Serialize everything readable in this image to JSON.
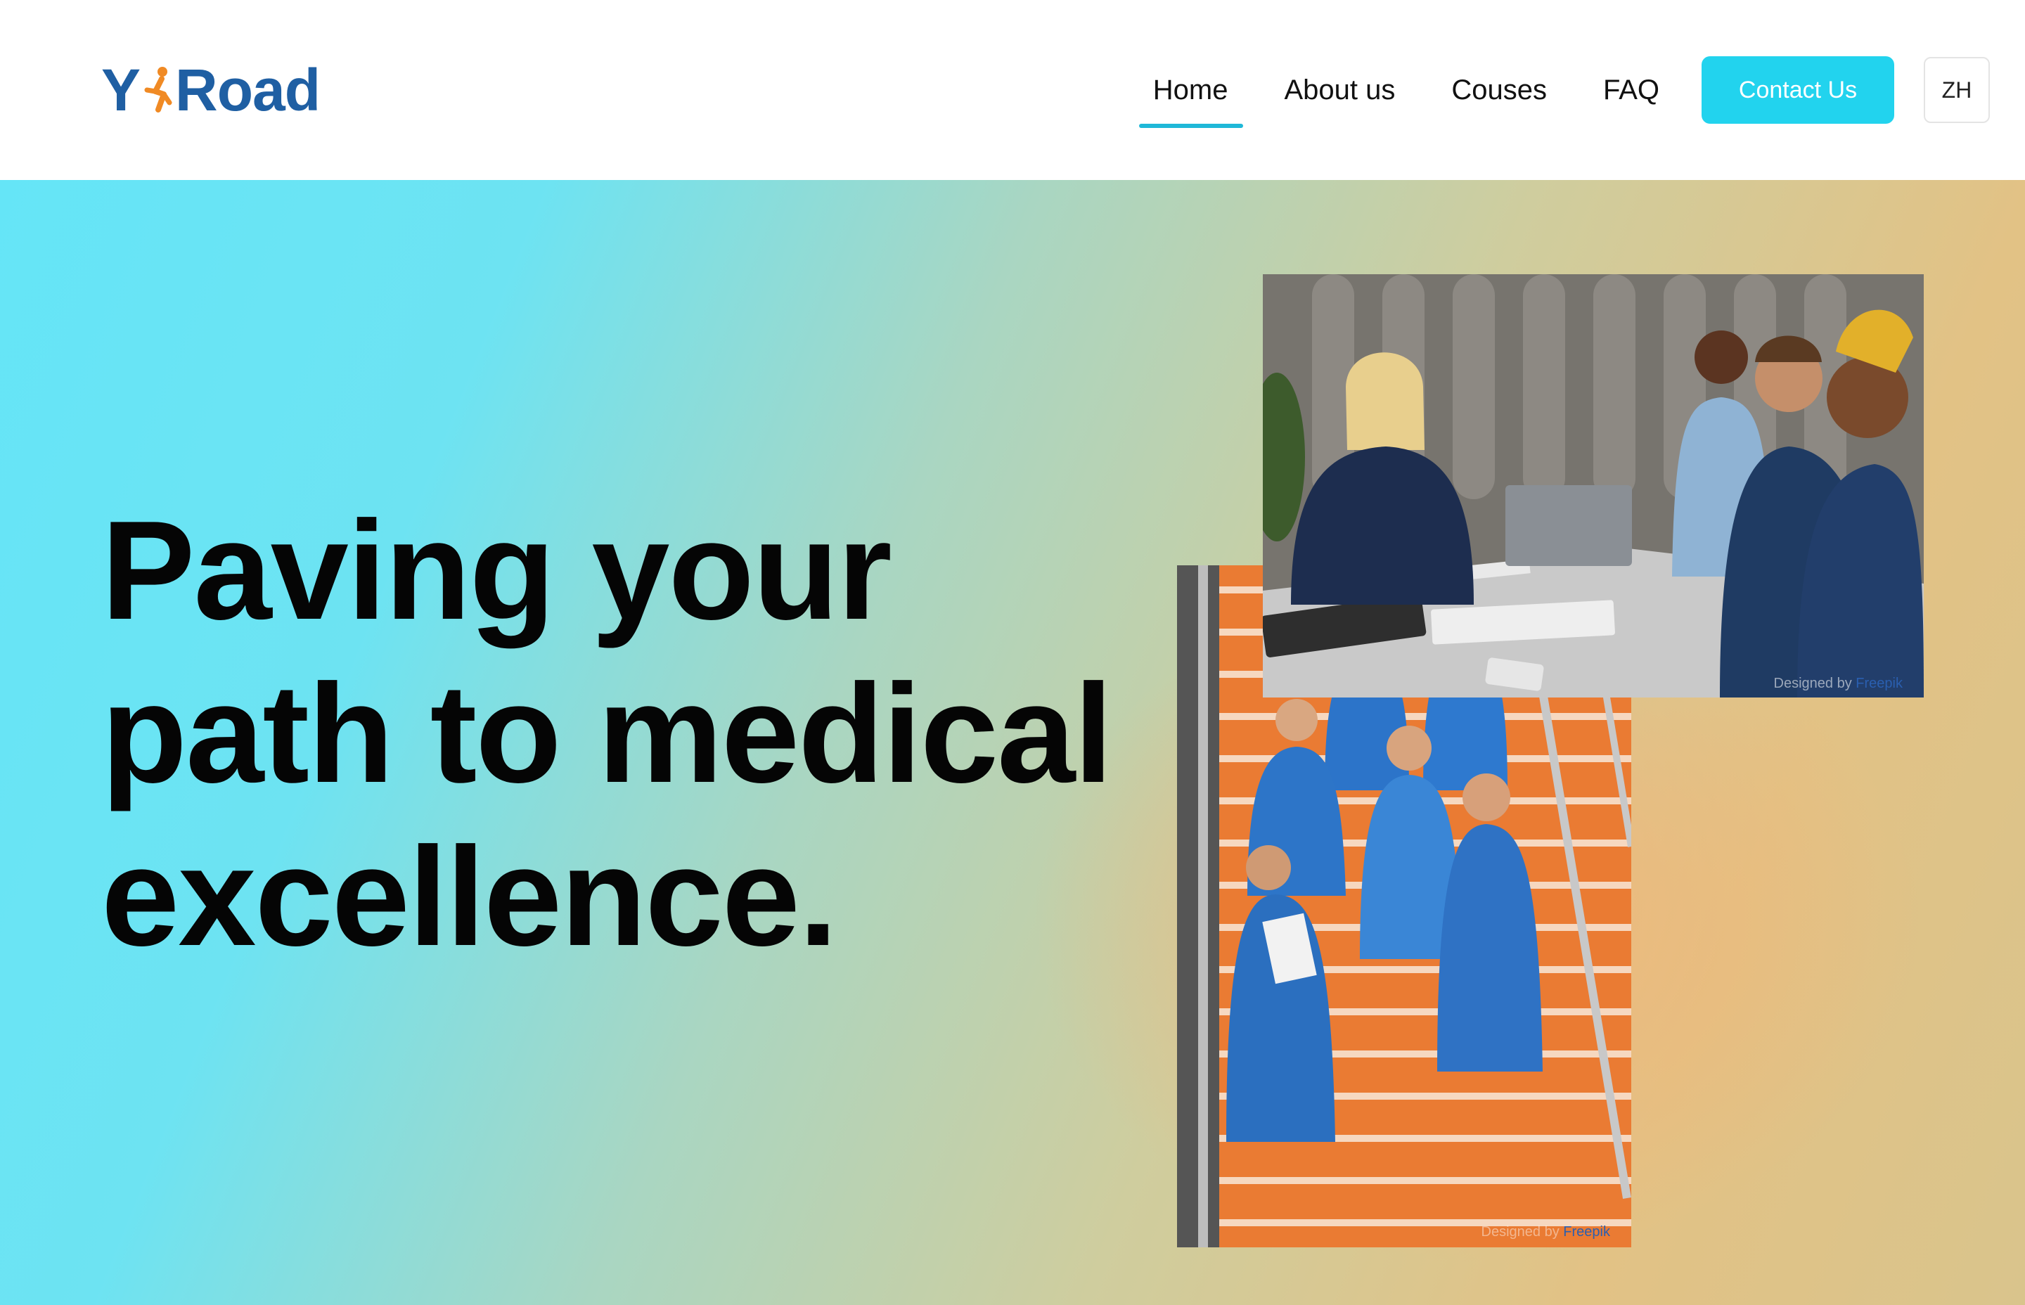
{
  "header": {
    "logo": {
      "text_left": "Y",
      "text_right": "Road",
      "icon": "runner-logo-icon"
    },
    "nav": [
      {
        "label": "Home",
        "active": true
      },
      {
        "label": "About us",
        "active": false
      },
      {
        "label": "Couses",
        "active": false
      },
      {
        "label": "FAQ",
        "active": false
      }
    ],
    "contact_label": "Contact Us",
    "lang_label": "ZH"
  },
  "hero": {
    "heading_lines": [
      "Paving your",
      "path to medical",
      "excellence."
    ],
    "images": [
      {
        "subject": "medical team meeting at table",
        "credit_prefix": "Designed by",
        "credit_brand": "Freepik"
      },
      {
        "subject": "medical students sitting on orange stairs",
        "credit_prefix": "Designed by",
        "credit_brand": "Freepik"
      }
    ]
  },
  "colors": {
    "accent": "#22d3ee",
    "nav_underline": "#1fb8d8",
    "logo_blue": "#1f5fa3",
    "logo_orange": "#f08a24",
    "gradient_start": "#65e5f7",
    "gradient_end": "#e2c285"
  }
}
